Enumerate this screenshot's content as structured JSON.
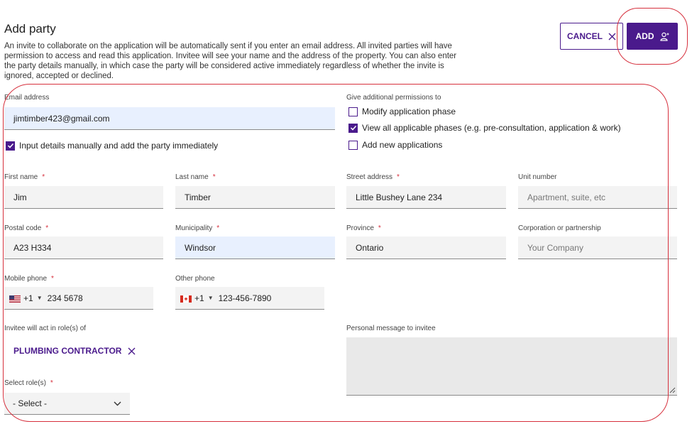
{
  "header": {
    "title": "Add party",
    "intro": "An invite to collaborate on the application will be automatically sent if you enter an email address. All invited parties will have permission to access and read this application. Invitee will see your name and the address of the property. You can also enter the party details manually, in which case the party will be considered active immediately regardless of whether the invite is ignored, accepted or declined.",
    "cancel_label": "CANCEL",
    "add_label": "ADD"
  },
  "email": {
    "label": "Email address",
    "value": "jimtimber423@gmail.com"
  },
  "manual_input": {
    "label": "Input details manually and add the party immediately",
    "checked": true
  },
  "permissions": {
    "label": "Give additional permissions to",
    "options": [
      {
        "label": "Modify application phase",
        "checked": false
      },
      {
        "label": "View all applicable phases (e.g. pre-consultation, application & work)",
        "checked": true
      },
      {
        "label": "Add new applications",
        "checked": false
      }
    ]
  },
  "fields": {
    "first_name": {
      "label": "First name",
      "required_mark": "*",
      "value": "Jim"
    },
    "last_name": {
      "label": "Last name",
      "required_mark": "*",
      "value": "Timber"
    },
    "street_address": {
      "label": "Street address",
      "required_mark": "*",
      "value": "Little Bushey Lane 234"
    },
    "unit_number": {
      "label": "Unit number",
      "placeholder": "Apartment, suite, etc"
    },
    "postal_code": {
      "label": "Postal code",
      "required_mark": "*",
      "value": "A23 H334"
    },
    "municipality": {
      "label": "Municipality",
      "required_mark": "*",
      "value": "Windsor"
    },
    "province": {
      "label": "Province",
      "required_mark": "*",
      "value": "Ontario"
    },
    "corporation": {
      "label": "Corporation or partnership",
      "placeholder": "Your Company"
    },
    "mobile_phone": {
      "label": "Mobile phone",
      "required_mark": "*",
      "country_code": "+1",
      "value": "234 5678"
    },
    "other_phone": {
      "label": "Other phone",
      "country_code": "+1",
      "placeholder": "123-456-7890"
    }
  },
  "roles": {
    "label": "Invitee will act in role(s) of",
    "selected": [
      "PLUMBING CONTRACTOR"
    ],
    "select_label": "Select role(s)",
    "select_required_mark": "*",
    "select_value": "- Select -"
  },
  "message": {
    "label": "Personal message to invitee"
  },
  "colors": {
    "accent": "#4a1a8c",
    "annotation": "#d6303d",
    "field_bg": "#f3f3f3",
    "autofill_bg": "#e8f0fe"
  },
  "icons": {
    "cancel": "close-icon",
    "add": "person-add-icon",
    "remove_role": "close-icon",
    "select": "chevron-down-icon",
    "us_flag": "us-flag-icon",
    "ca_flag": "canada-flag-icon"
  }
}
